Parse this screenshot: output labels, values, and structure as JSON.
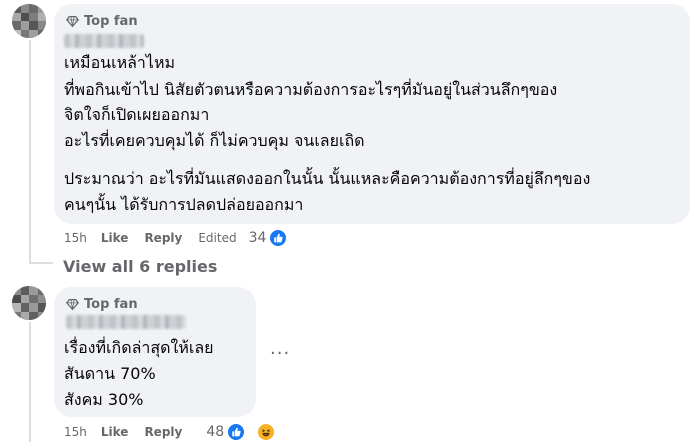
{
  "comments": [
    {
      "badge": "Top fan",
      "lines": [
        "เหมือนเหล้าไหม",
        "ที่พอกินเข้าไป นิสัยตัวตนหรือความต้องการอะไรๆที่มันอยู่ในส่วนลึกๆของ",
        "จิตใจก็เปิดเผยออกมา",
        "อะไรที่เคยควบคุมได้ ก็ไม่ควบคุม จนเลยเถิด",
        "ประมาณว่า อะไรที่มันแสดงออกในนั้น นั้นแหละคือความต้องการที่อยู่ลึกๆของ",
        "คนๆนั้น ได้รับการปลดปล่อยออกมา"
      ],
      "time": "15h",
      "like": "Like",
      "reply": "Reply",
      "edited": "Edited",
      "reactions": "34",
      "reaction_icons": [
        "like-icon"
      ]
    },
    {
      "badge": "Top fan",
      "lines": [
        "เรื่องที่เกิดล่าสุดให้เลย",
        "สันดาน 70%",
        "สังคม 30%"
      ],
      "time": "15h",
      "like": "Like",
      "reply": "Reply",
      "reactions": "48",
      "reaction_icons": [
        "like-icon",
        "haha-icon"
      ]
    }
  ],
  "view_replies": "View all 6 replies",
  "more_options": "..."
}
